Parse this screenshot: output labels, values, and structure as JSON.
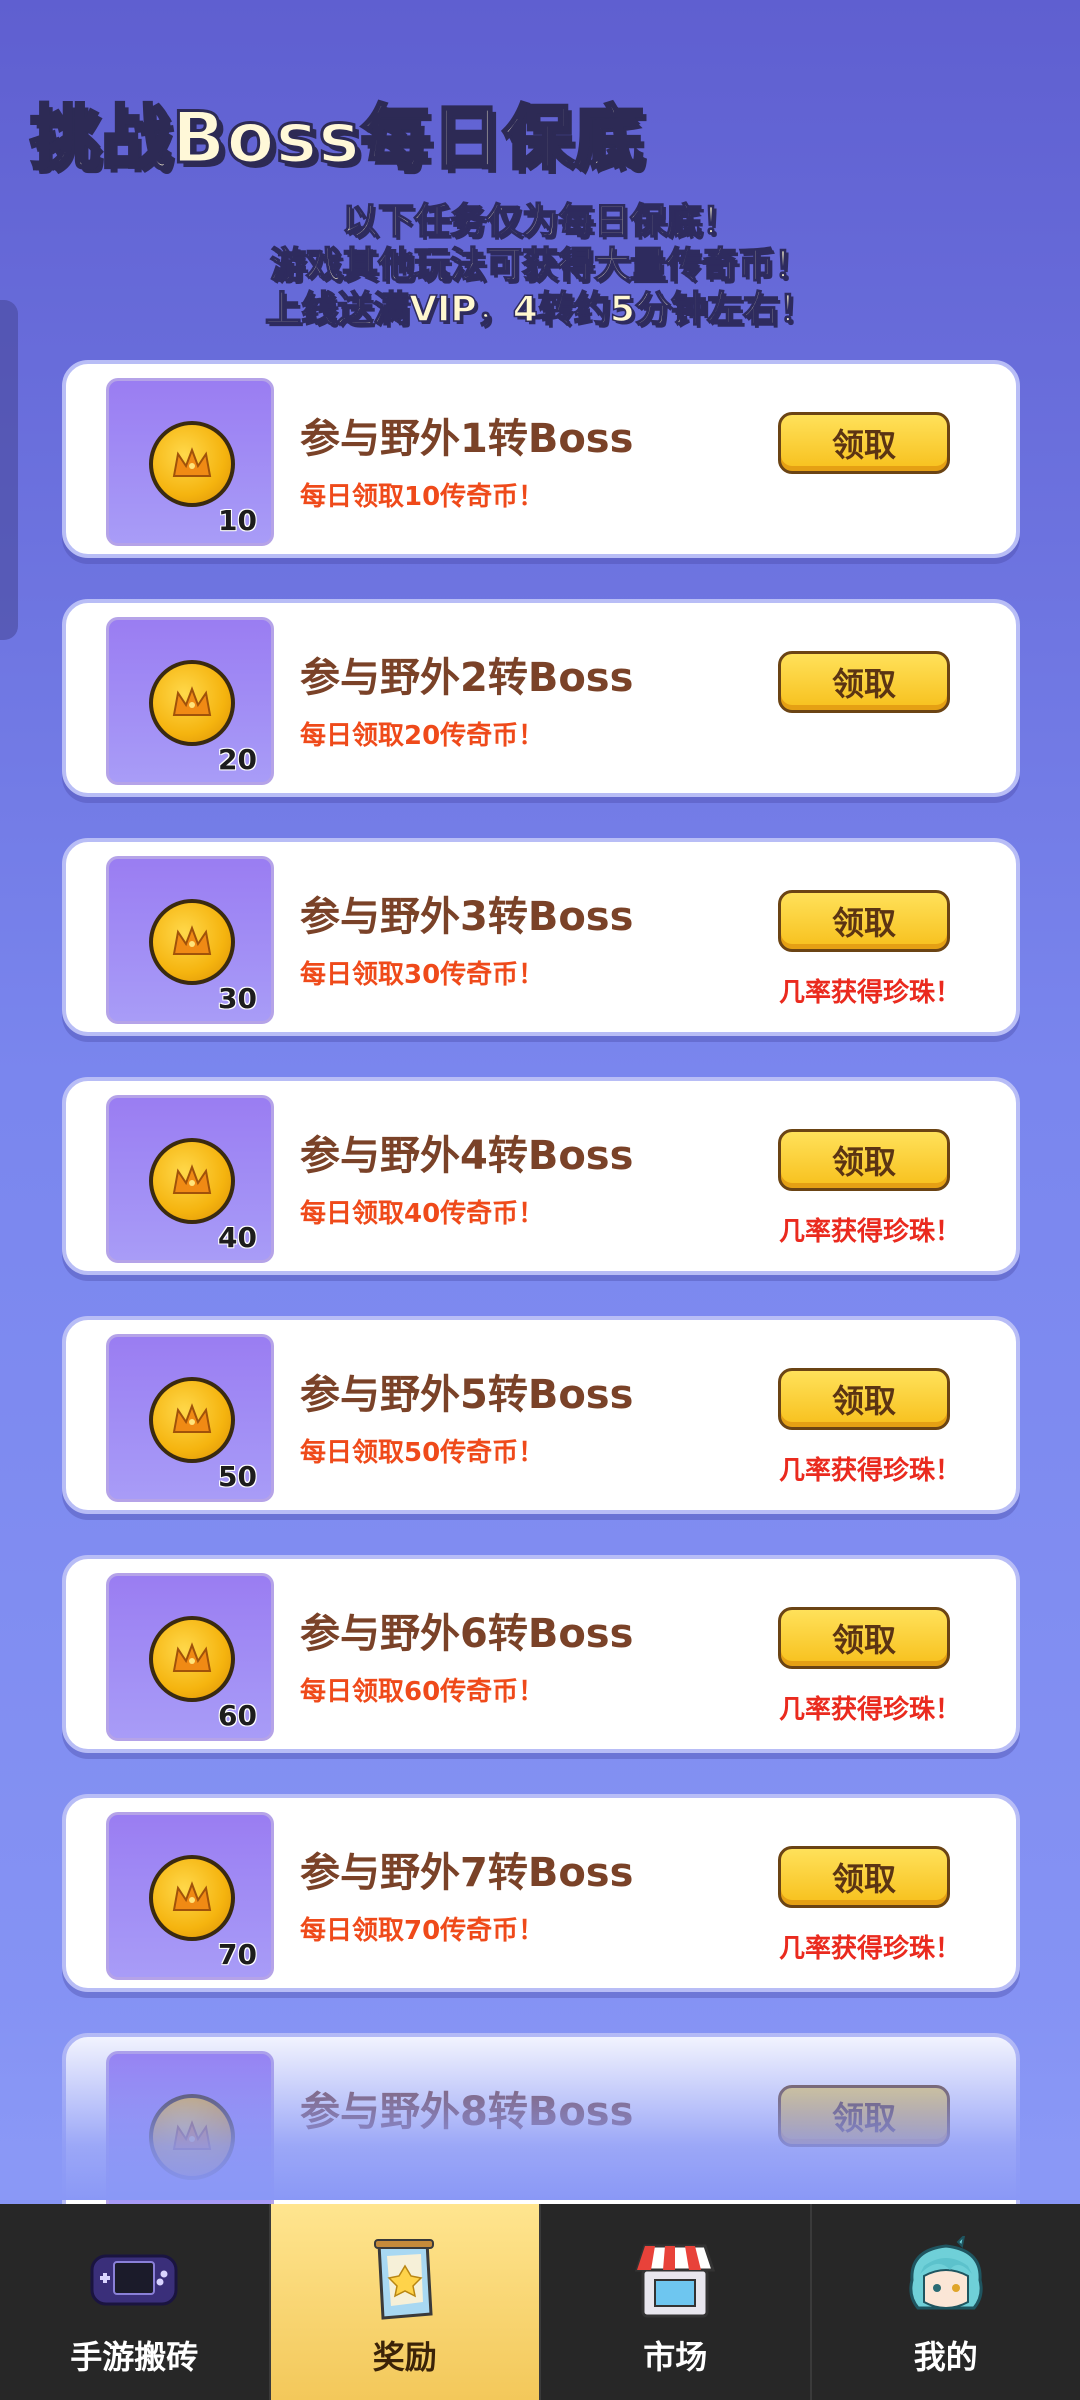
{
  "header": {
    "title": "挑战Boss每日保底",
    "notice_lines": [
      "以下任务仅为每日保底！",
      "游戏其他玩法可获得大量传奇币！",
      "上线送满VIP，4转约5分钟左右！"
    ]
  },
  "tasks": [
    {
      "title": "参与野外1转Boss",
      "subtitle": "每日领取10传奇币！",
      "reward": "10",
      "button": "领取",
      "note": ""
    },
    {
      "title": "参与野外2转Boss",
      "subtitle": "每日领取20传奇币！",
      "reward": "20",
      "button": "领取",
      "note": ""
    },
    {
      "title": "参与野外3转Boss",
      "subtitle": "每日领取30传奇币！",
      "reward": "30",
      "button": "领取",
      "note": "几率获得珍珠！"
    },
    {
      "title": "参与野外4转Boss",
      "subtitle": "每日领取40传奇币！",
      "reward": "40",
      "button": "领取",
      "note": "几率获得珍珠！"
    },
    {
      "title": "参与野外5转Boss",
      "subtitle": "每日领取50传奇币！",
      "reward": "50",
      "button": "领取",
      "note": "几率获得珍珠！"
    },
    {
      "title": "参与野外6转Boss",
      "subtitle": "每日领取60传奇币！",
      "reward": "60",
      "button": "领取",
      "note": "几率获得珍珠！"
    },
    {
      "title": "参与野外7转Boss",
      "subtitle": "每日领取70传奇币！",
      "reward": "70",
      "button": "领取",
      "note": "几率获得珍珠！"
    },
    {
      "title": "参与野外8转Boss",
      "subtitle": "",
      "reward": "",
      "button": "领取",
      "note": ""
    }
  ],
  "tabbar": {
    "items": [
      {
        "label": "手游搬砖",
        "icon": "handheld-console-icon",
        "active": false
      },
      {
        "label": "奖励",
        "icon": "reward-scroll-icon",
        "active": true
      },
      {
        "label": "市场",
        "icon": "shop-stall-icon",
        "active": false
      },
      {
        "label": "我的",
        "icon": "character-avatar-icon",
        "active": false
      }
    ]
  },
  "colors": {
    "background_top": "#5f5fd0",
    "background_bottom": "#8a98f6",
    "title_text": "#7a4228",
    "subtitle_text": "#ef4a1a",
    "note_text": "#ea2a1e",
    "button_fill": "#f7c01c",
    "tabbar_bg": "#272727",
    "tab_active_bg": "#f3c85a"
  }
}
